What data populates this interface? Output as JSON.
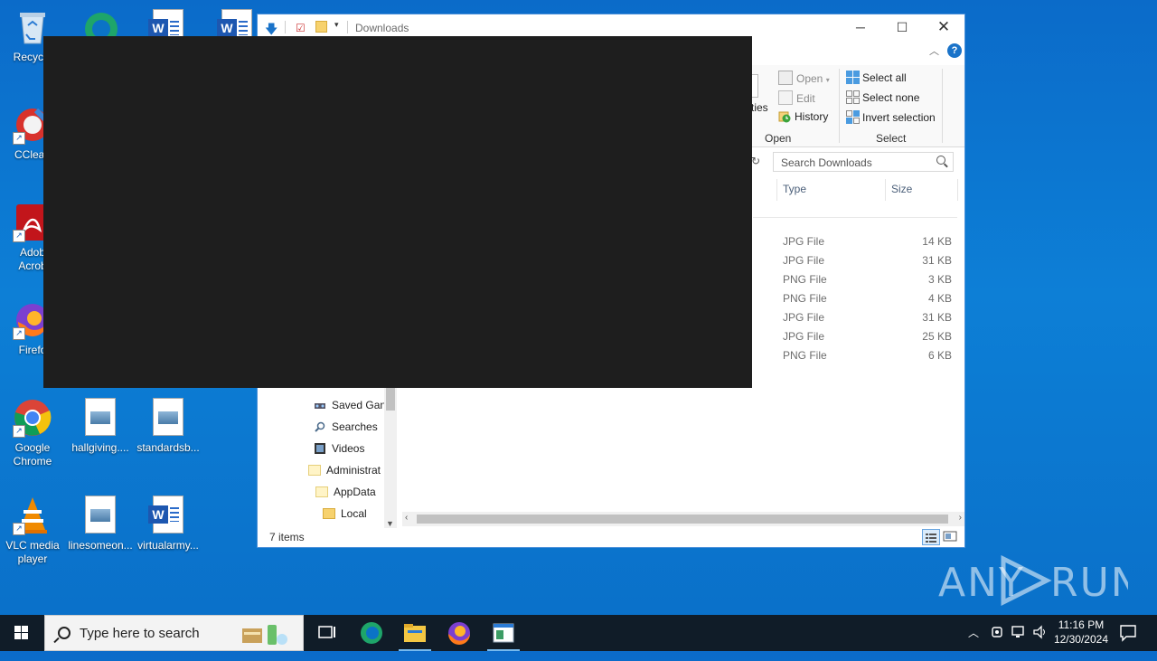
{
  "desktop": {
    "icons": [
      {
        "label": "Recycle",
        "kind": "recycle-bin"
      },
      {
        "label": "CClean",
        "kind": "ccleaner"
      },
      {
        "label": "Adob\nAcrob",
        "kind": "acrobat"
      },
      {
        "label": "Firefo",
        "kind": "firefox"
      },
      {
        "label": "Google Chrome",
        "kind": "chrome"
      },
      {
        "label": "hallgiving....",
        "kind": "image-file"
      },
      {
        "label": "standardsb...",
        "kind": "image-file"
      },
      {
        "label": "VLC media player",
        "kind": "vlc"
      },
      {
        "label": "linesomeon...",
        "kind": "image-file"
      },
      {
        "label": "virtualarmy...",
        "kind": "word-doc"
      }
    ]
  },
  "explorer": {
    "title": "Downloads",
    "ribbon": {
      "open_group": {
        "partial_label": "rties",
        "open": "Open",
        "edit": "Edit",
        "history": "History",
        "label": "Open"
      },
      "select_group": {
        "select_all": "Select all",
        "select_none": "Select none",
        "invert_selection": "Invert selection",
        "label": "Select"
      }
    },
    "search": {
      "placeholder": "Search Downloads"
    },
    "columns": {
      "type": "Type",
      "size": "Size"
    },
    "files": [
      {
        "type": "JPG File",
        "size": "14 KB"
      },
      {
        "type": "JPG File",
        "size": "31 KB"
      },
      {
        "type": "PNG File",
        "size": "3 KB"
      },
      {
        "type": "PNG File",
        "size": "4 KB"
      },
      {
        "type": "JPG File",
        "size": "31 KB"
      },
      {
        "type": "JPG File",
        "size": "25 KB"
      },
      {
        "type": "PNG File",
        "size": "6 KB"
      }
    ],
    "nav": [
      {
        "label": "Saved Gan",
        "icon": "saved-games-icon"
      },
      {
        "label": "Searches",
        "icon": "search-icon"
      },
      {
        "label": "Videos",
        "icon": "videos-icon"
      },
      {
        "label": "Administrat",
        "icon": "folder-icon"
      },
      {
        "label": "AppData",
        "icon": "folder-icon"
      },
      {
        "label": "Local",
        "icon": "folder-icon"
      }
    ],
    "status": {
      "item_count": "7 items"
    }
  },
  "watermark": "ANY RUN",
  "taskbar": {
    "search_placeholder": "Type here to search",
    "time": "11:16 PM",
    "date": "12/30/2024"
  },
  "colors": {
    "accent": "#0078d7",
    "taskbar": "#101c28",
    "desktop": "#0b6bc9"
  }
}
